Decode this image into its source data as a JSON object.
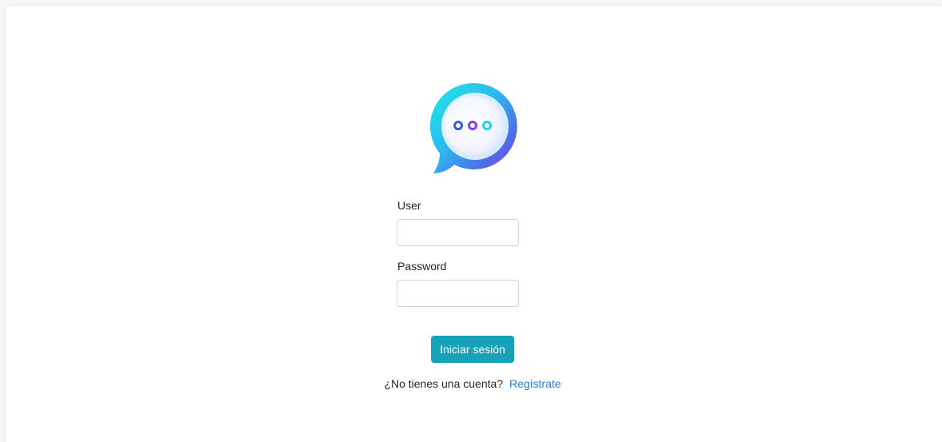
{
  "logo": {
    "icon": "chat-bubble-icon"
  },
  "form": {
    "user_label": "User",
    "user_value": "",
    "password_label": "Password",
    "password_value": "",
    "submit_label": "Iniciar sesión"
  },
  "register": {
    "prompt": "¿No tienes una cuenta?",
    "link_label": "Regístrate"
  },
  "colors": {
    "button": "#17a2b8",
    "link": "#1b84d6",
    "logo_cyan": "#1fe0e8",
    "logo_blue": "#3a73e8",
    "logo_purple": "#8a3ee6"
  }
}
